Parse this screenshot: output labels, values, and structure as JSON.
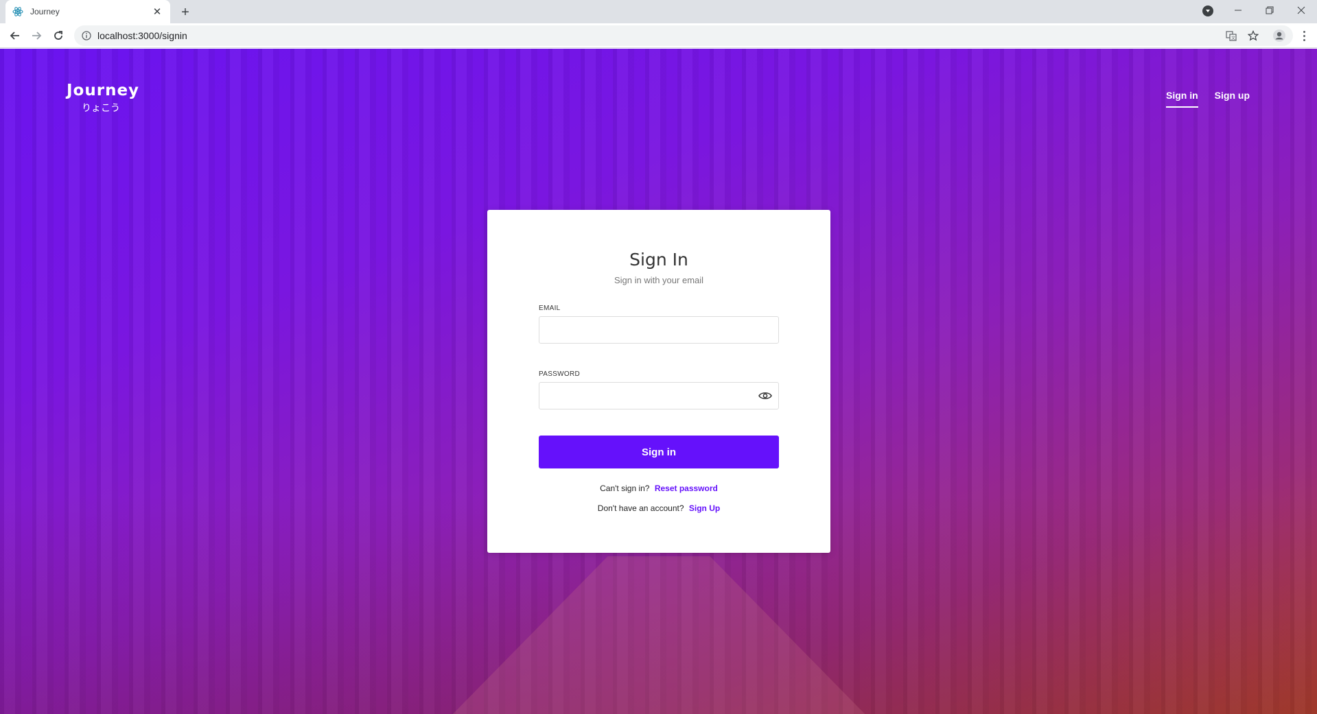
{
  "browser": {
    "tab_title": "Journey",
    "url": "localhost:3000/signin",
    "new_tab_label": "+",
    "close_tab_label": "✕"
  },
  "header": {
    "brand_name": "Journey",
    "brand_subtitle": "りょこう",
    "nav": [
      {
        "label": "Sign in",
        "active": true
      },
      {
        "label": "Sign up",
        "active": false
      }
    ]
  },
  "form": {
    "title": "Sign In",
    "subtitle": "Sign in with your email",
    "email_label": "EMAIL",
    "email_value": "",
    "password_label": "PASSWORD",
    "password_value": "",
    "submit_label": "Sign in",
    "cant_sign_in_text": "Can't sign in?",
    "reset_link": "Reset password",
    "no_account_text": "Don't have an account?",
    "signup_link": "Sign Up"
  },
  "colors": {
    "accent": "#6511fb",
    "gradient_start": "#6a14f0",
    "gradient_end": "#b5452a"
  }
}
